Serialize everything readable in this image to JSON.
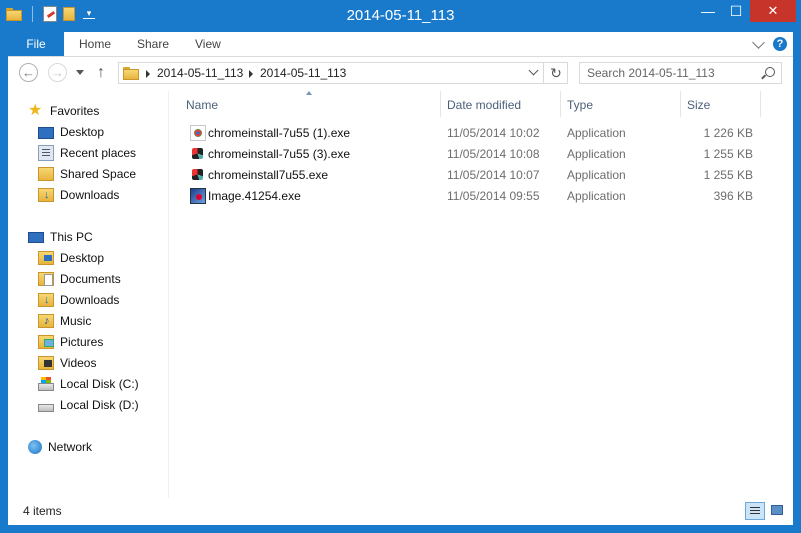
{
  "window": {
    "title": "2014-05-11_113",
    "minimize": "—",
    "maximize": "☐",
    "close": "✕"
  },
  "ribbon": {
    "tabs": [
      "File",
      "Home",
      "Share",
      "View"
    ],
    "help": "?"
  },
  "address": {
    "back": "←",
    "forward": "→",
    "up": "↑",
    "refresh": "↻",
    "breadcrumbs": [
      "2014-05-11_113",
      "2014-05-11_113"
    ]
  },
  "search": {
    "placeholder": "Search 2014-05-11_113"
  },
  "navpane": {
    "favorites": {
      "label": "Favorites",
      "items": [
        "Desktop",
        "Recent places",
        "Shared Space",
        "Downloads"
      ]
    },
    "this_pc": {
      "label": "This PC",
      "items": [
        "Desktop",
        "Documents",
        "Downloads",
        "Music",
        "Pictures",
        "Videos",
        "Local Disk (C:)",
        "Local Disk (D:)"
      ]
    },
    "network": {
      "label": "Network"
    }
  },
  "filelist": {
    "columns": [
      "Name",
      "Date modified",
      "Type",
      "Size"
    ],
    "rows": [
      {
        "name": "chromeinstall-7u55 (1).exe",
        "date": "11/05/2014 10:02",
        "type": "Application",
        "size": "1 226 KB",
        "icon": "exe-icon"
      },
      {
        "name": "chromeinstall-7u55 (3).exe",
        "date": "11/05/2014 10:08",
        "type": "Application",
        "size": "1 255 KB",
        "icon": "setup-icon"
      },
      {
        "name": "chromeinstall7u55.exe",
        "date": "11/05/2014 10:07",
        "type": "Application",
        "size": "1 255 KB",
        "icon": "setup-icon"
      },
      {
        "name": "Image.41254.exe",
        "date": "11/05/2014 09:55",
        "type": "Application",
        "size": "396 KB",
        "icon": "image-exe-icon"
      }
    ]
  },
  "status": {
    "item_count": "4 items"
  },
  "colors": {
    "accent": "#1979ca",
    "close": "#c7342a"
  }
}
